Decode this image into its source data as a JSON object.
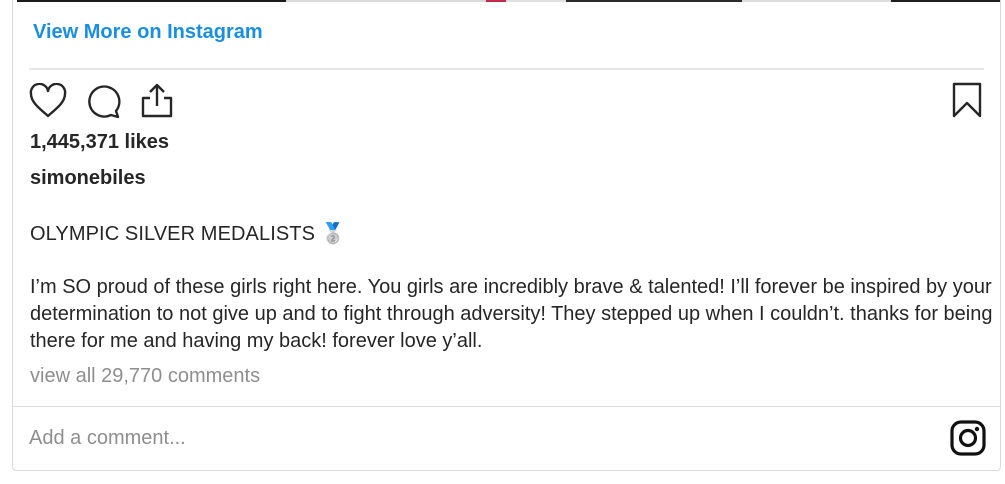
{
  "embed": {
    "view_more_label": "View More on Instagram",
    "likes_text": "1,445,371 likes",
    "username": "simonebiles",
    "caption_title": "OLYMPIC SILVER MEDALISTS 🥈",
    "caption_body": "I’m SO proud of these girls right here. You girls are incredibly brave & talented! I’ll forever be inspired by your determination to not give up and to fight through adversity! They stepped up when I couldn’t. thanks for being there for me and having my back! forever love y’all.",
    "comments_link": "view all 29,770 comments",
    "comment_placeholder": "Add a comment..."
  },
  "icons": {
    "like": "heart-icon",
    "comment": "comment-bubble-icon",
    "share": "share-icon",
    "save": "bookmark-icon",
    "brand": "instagram-logo-icon"
  },
  "colors": {
    "link": "#1a8fe0",
    "text": "#262626",
    "muted": "#8e8e8e",
    "border": "#dbdbdb"
  }
}
